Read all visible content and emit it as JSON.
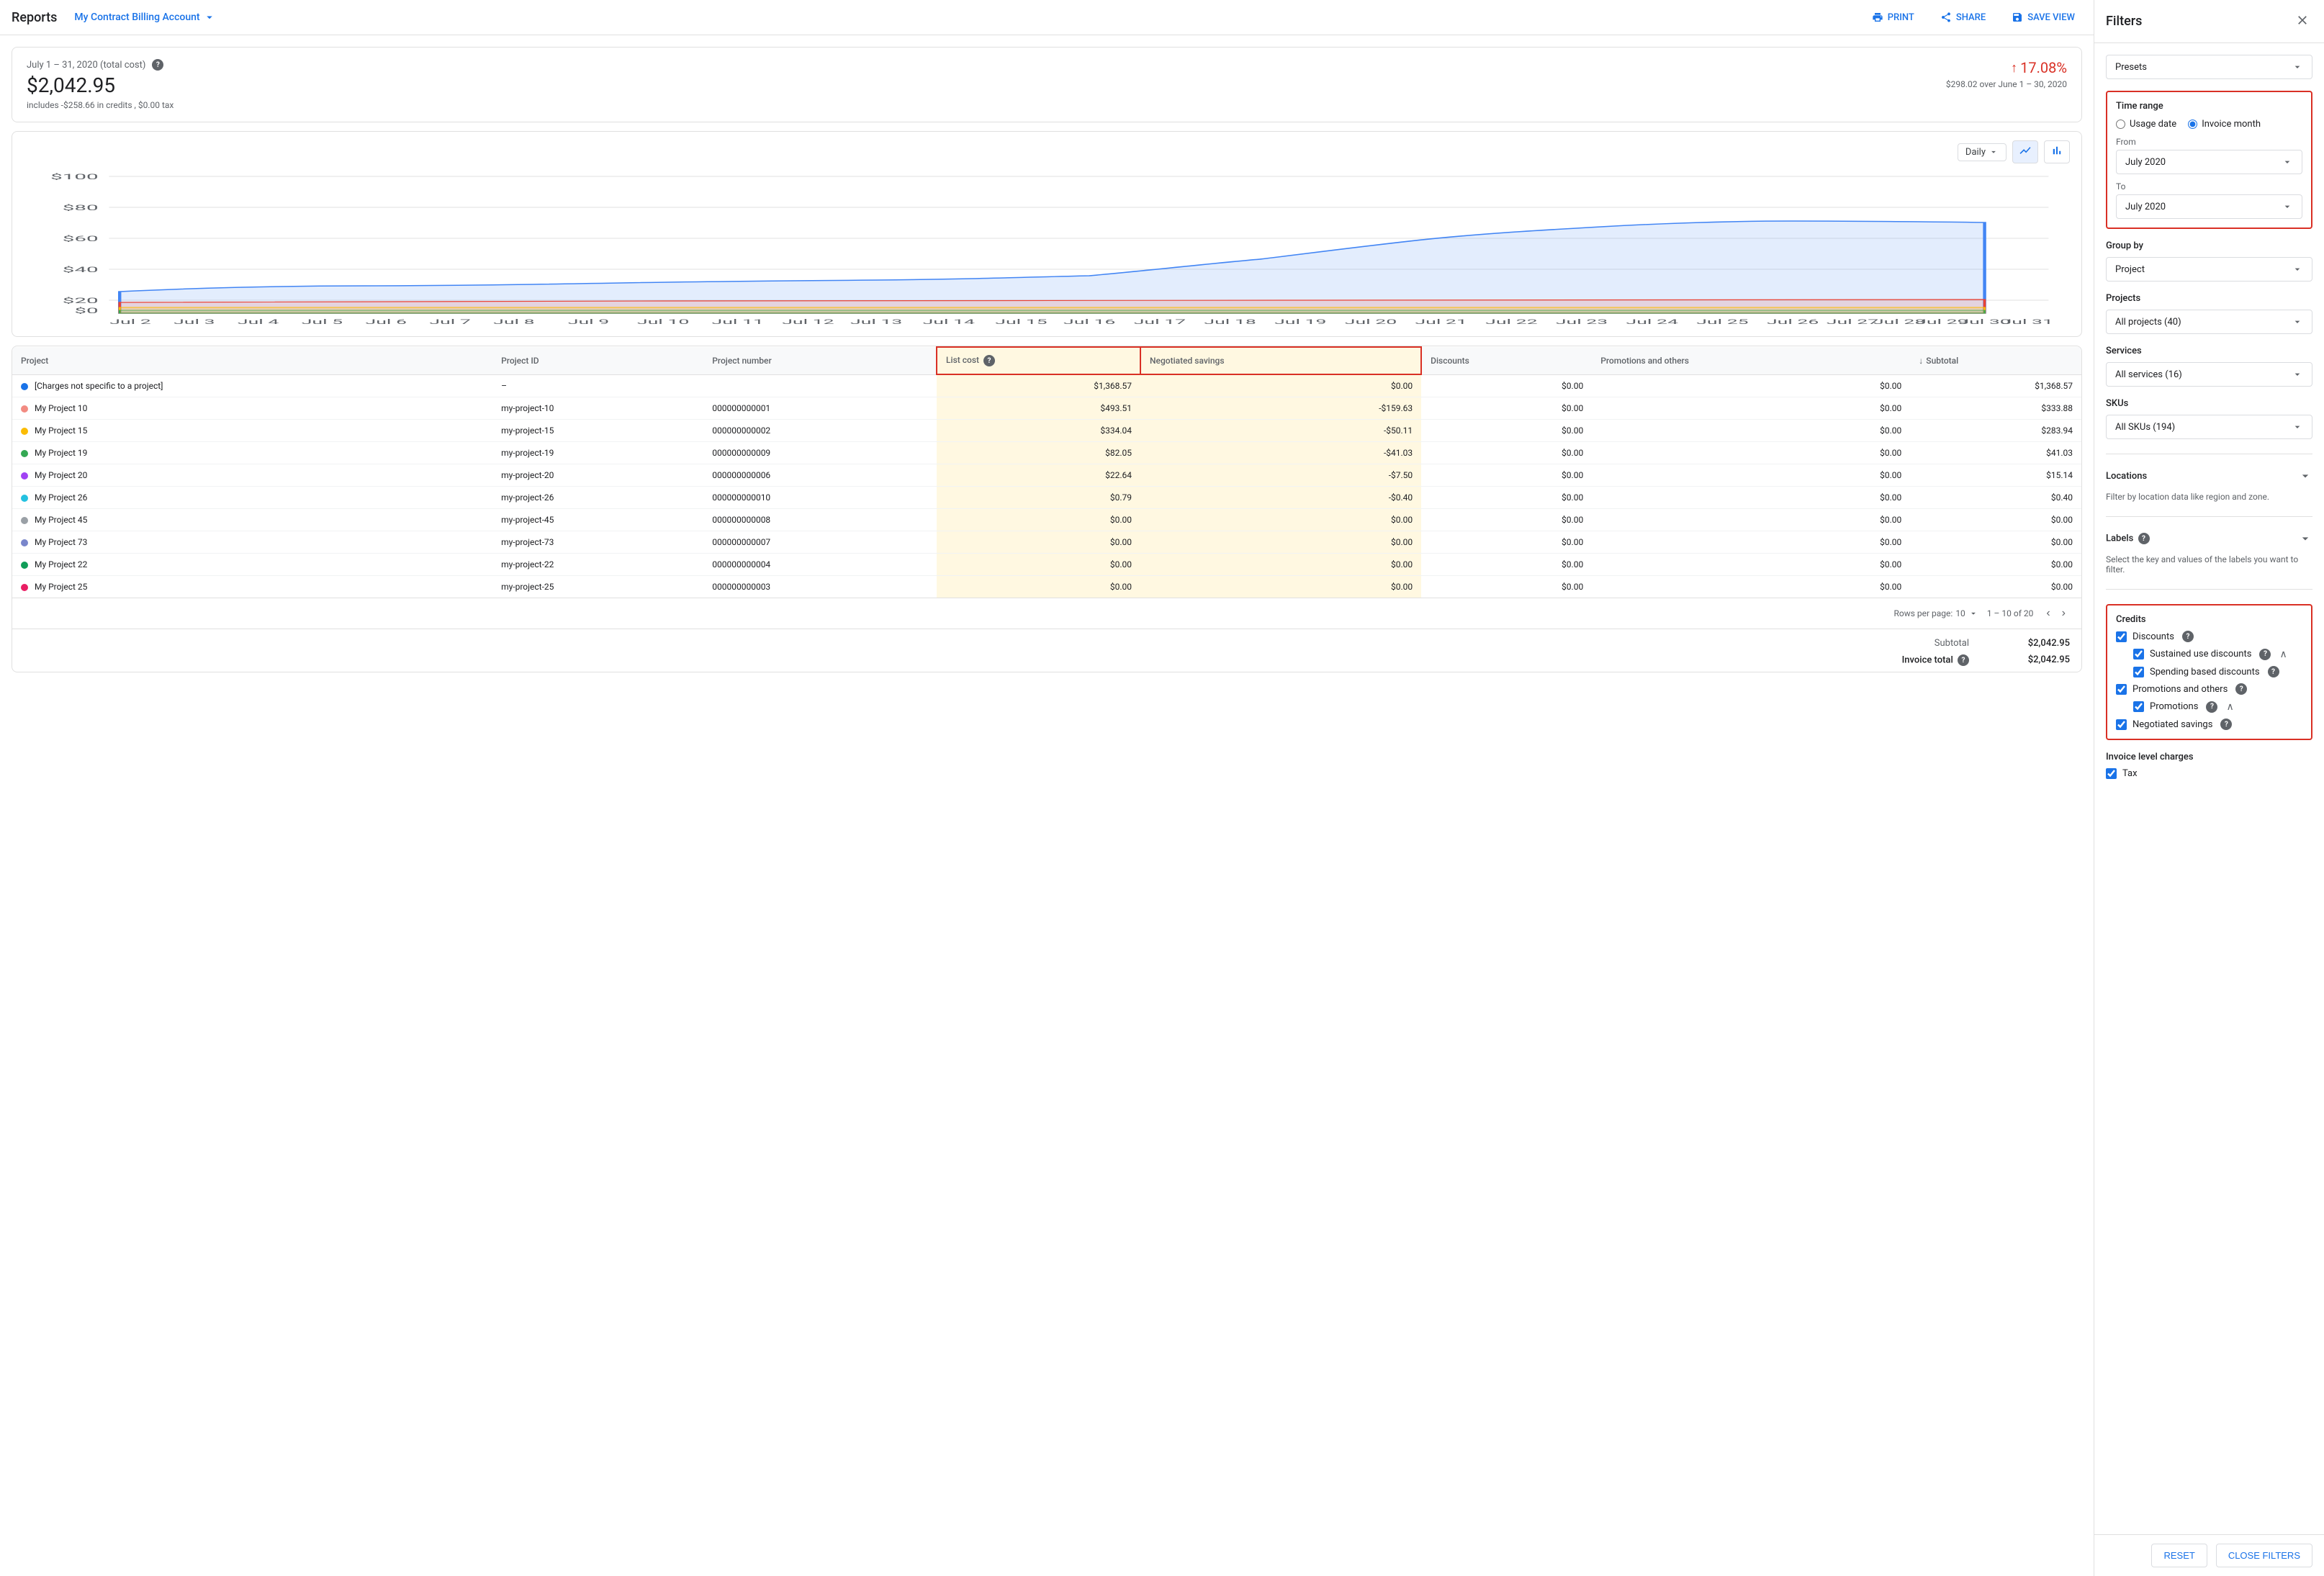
{
  "topbar": {
    "title": "Reports",
    "account": "My Contract Billing Account",
    "print_label": "PRINT",
    "share_label": "SHARE",
    "save_view_label": "SAVE VIEW"
  },
  "summary": {
    "period": "July 1 – 31, 2020 (total cost)",
    "amount": "$2,042.95",
    "note": "includes -$258.66 in credits , $0.00 tax",
    "change_pct": "17.08%",
    "change_compare": "$298.02 over June 1 – 30, 2020"
  },
  "chart": {
    "granularity": "Daily",
    "y_labels": [
      "$100",
      "$80",
      "$60",
      "$40",
      "$20",
      "$0"
    ],
    "x_labels": [
      "Jul 2",
      "Jul 3",
      "Jul 4",
      "Jul 5",
      "Jul 6",
      "Jul 7",
      "Jul 8",
      "Jul 9",
      "Jul 10",
      "Jul 11",
      "Jul 12",
      "Jul 13",
      "Jul 14",
      "Jul 15",
      "Jul 16",
      "Jul 17",
      "Jul 18",
      "Jul 19",
      "Jul 20",
      "Jul 21",
      "Jul 22",
      "Jul 23",
      "Jul 24",
      "Jul 25",
      "Jul 26",
      "Jul 27",
      "Jul 28",
      "Jul 29",
      "Jul 30",
      "Jul 31"
    ]
  },
  "table": {
    "columns": [
      "Project",
      "Project ID",
      "Project number",
      "List cost",
      "Negotiated savings",
      "Discounts",
      "Promotions and others",
      "Subtotal"
    ],
    "rows": [
      {
        "project": "[Charges not specific to a project]",
        "dot_color": "#1a73e8",
        "project_id": "–",
        "project_number": "",
        "list_cost": "$1,368.57",
        "negotiated": "$0.00",
        "discounts": "$0.00",
        "promotions": "$0.00",
        "subtotal": "$1,368.57"
      },
      {
        "project": "My Project 10",
        "dot_color": "#f28b82",
        "project_id": "my-project-10",
        "project_number": "000000000001",
        "list_cost": "$493.51",
        "negotiated": "-$159.63",
        "discounts": "$0.00",
        "promotions": "$0.00",
        "subtotal": "$333.88"
      },
      {
        "project": "My Project 15",
        "dot_color": "#fbbc04",
        "project_id": "my-project-15",
        "project_number": "000000000002",
        "list_cost": "$334.04",
        "negotiated": "-$50.11",
        "discounts": "$0.00",
        "promotions": "$0.00",
        "subtotal": "$283.94"
      },
      {
        "project": "My Project 19",
        "dot_color": "#34a853",
        "project_id": "my-project-19",
        "project_number": "000000000009",
        "list_cost": "$82.05",
        "negotiated": "-$41.03",
        "discounts": "$0.00",
        "promotions": "$0.00",
        "subtotal": "$41.03"
      },
      {
        "project": "My Project 20",
        "dot_color": "#a142f4",
        "project_id": "my-project-20",
        "project_number": "000000000006",
        "list_cost": "$22.64",
        "negotiated": "-$7.50",
        "discounts": "$0.00",
        "promotions": "$0.00",
        "subtotal": "$15.14"
      },
      {
        "project": "My Project 26",
        "dot_color": "#24c1e0",
        "project_id": "my-project-26",
        "project_number": "000000000010",
        "list_cost": "$0.79",
        "negotiated": "-$0.40",
        "discounts": "$0.00",
        "promotions": "$0.00",
        "subtotal": "$0.40"
      },
      {
        "project": "My Project 45",
        "dot_color": "#9aa0a6",
        "project_id": "my-project-45",
        "project_number": "000000000008",
        "list_cost": "$0.00",
        "negotiated": "$0.00",
        "discounts": "$0.00",
        "promotions": "$0.00",
        "subtotal": "$0.00"
      },
      {
        "project": "My Project 73",
        "dot_color": "#7986cb",
        "project_id": "my-project-73",
        "project_number": "000000000007",
        "list_cost": "$0.00",
        "negotiated": "$0.00",
        "discounts": "$0.00",
        "promotions": "$0.00",
        "subtotal": "$0.00"
      },
      {
        "project": "My Project 22",
        "dot_color": "#0f9d58",
        "project_id": "my-project-22",
        "project_number": "000000000004",
        "list_cost": "$0.00",
        "negotiated": "$0.00",
        "discounts": "$0.00",
        "promotions": "$0.00",
        "subtotal": "$0.00"
      },
      {
        "project": "My Project 25",
        "dot_color": "#e91e63",
        "project_id": "my-project-25",
        "project_number": "000000000003",
        "list_cost": "$0.00",
        "negotiated": "$0.00",
        "discounts": "$0.00",
        "promotions": "$0.00",
        "subtotal": "$0.00"
      }
    ],
    "rows_per_page": "10",
    "pagination": "1 – 10 of 20",
    "subtotal_label": "Subtotal",
    "subtotal_value": "$2,042.95",
    "invoice_total_label": "Invoice total",
    "invoice_total_value": "$2,042.95"
  },
  "filters": {
    "title": "Filters",
    "presets_label": "Presets",
    "time_range_label": "Time range",
    "usage_date_label": "Usage date",
    "invoice_month_label": "Invoice month",
    "from_label": "From",
    "from_value": "July 2020",
    "to_label": "To",
    "to_value": "July 2020",
    "group_by_label": "Group by",
    "group_by_value": "Project",
    "projects_label": "Projects",
    "projects_value": "All projects (40)",
    "services_label": "Services",
    "services_value": "All services (16)",
    "skus_label": "SKUs",
    "skus_value": "All SKUs (194)",
    "locations_label": "Locations",
    "locations_desc": "Filter by location data like region and zone.",
    "labels_label": "Labels",
    "labels_desc": "Select the key and values of the labels you want to filter.",
    "credits_label": "Credits",
    "discounts_label": "Discounts",
    "sustained_use_label": "Sustained use discounts",
    "spending_based_label": "Spending based discounts",
    "promotions_and_others_label": "Promotions and others",
    "promotions_label": "Promotions",
    "negotiated_label": "Negotiated savings",
    "invoice_level_label": "Invoice level charges",
    "tax_label": "Tax",
    "reset_label": "RESET",
    "close_filters_label": "CLOSE FILTERS"
  }
}
